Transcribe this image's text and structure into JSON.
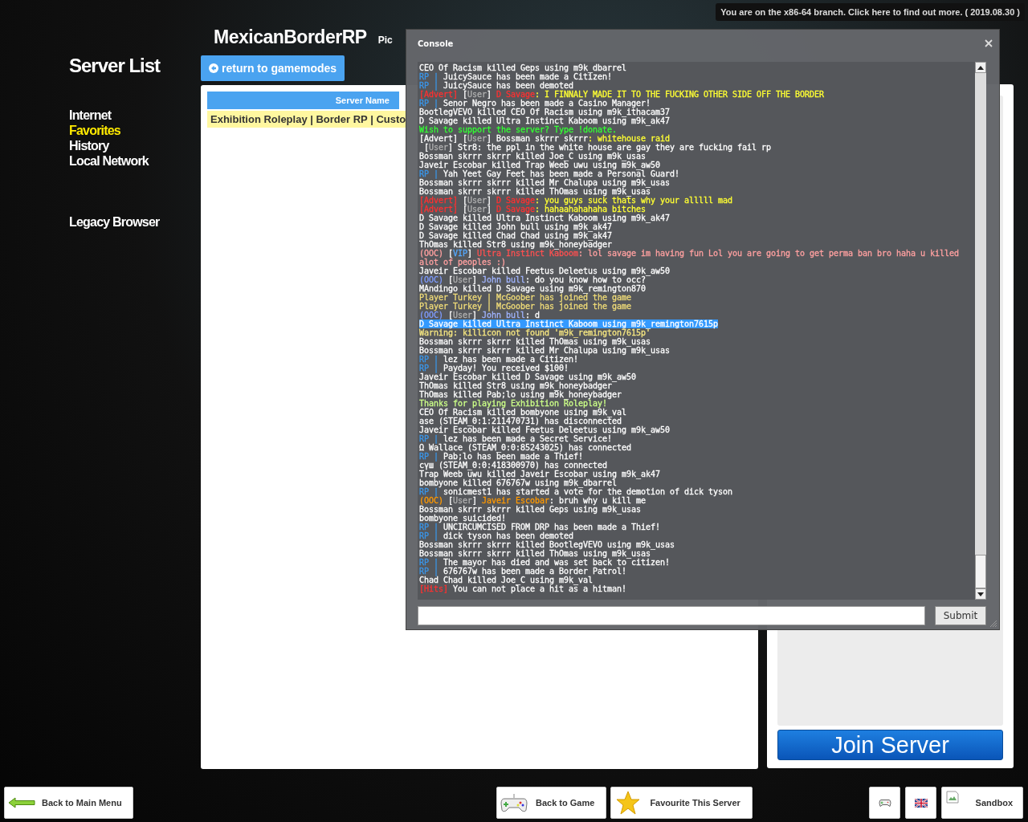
{
  "branch_notice": "You are on the x86-64 branch. Click here to find out more. ( 2019.08.30 )",
  "sidebar": {
    "title": "Server List",
    "items": [
      {
        "label": "Internet",
        "selected": false
      },
      {
        "label": "Favorites",
        "selected": true
      },
      {
        "label": "History",
        "selected": false
      },
      {
        "label": "Local Network",
        "selected": false
      }
    ],
    "legacy": "Legacy Browser"
  },
  "header": {
    "title": "MexicanBorderRP",
    "subtitle": "Pic",
    "back_button": "return to gamemodes"
  },
  "table": {
    "columns": [
      "Server Name"
    ],
    "rows": [
      {
        "name": "Exhibition Roleplay | Border RP | Custo",
        "selected": true
      }
    ]
  },
  "join_button": "Join Server",
  "console": {
    "title": "Console",
    "submit": "Submit",
    "lines": [
      {
        "selected": false,
        "segments": [
          {
            "text": "CEO Of Racism killed Geps using m9k_dbarrel"
          }
        ]
      },
      {
        "selected": false,
        "segments": [
          {
            "text": "RP | ",
            "color": "#3a96ea"
          },
          {
            "text": "JuicySauce has been made a Citizen!"
          }
        ]
      },
      {
        "selected": false,
        "segments": [
          {
            "text": "RP | ",
            "color": "#3a96ea"
          },
          {
            "text": "JuicySauce has been demoted"
          }
        ]
      },
      {
        "selected": false,
        "segments": [
          {
            "text": "[Advert]",
            "color": "#ff3030"
          },
          {
            "text": " ["
          },
          {
            "text": "User",
            "color": "#b0b0b0"
          },
          {
            "text": "] "
          },
          {
            "text": "D Savage",
            "color": "#ff3030"
          },
          {
            "text": ": I FINNALY MADE IT TO THE FUCKING OTHER SIDE OFF THE BORDER",
            "color": "#ffff33"
          }
        ]
      },
      {
        "selected": false,
        "segments": [
          {
            "text": "RP | ",
            "color": "#3a96ea"
          },
          {
            "text": "Senor Negro has been made a Casino Manager!"
          }
        ]
      },
      {
        "selected": false,
        "segments": [
          {
            "text": "BootlegVEVO killed CEO Of Racism using m9k_ithacam37"
          }
        ]
      },
      {
        "selected": false,
        "segments": [
          {
            "text": "D Savage killed Ultra Instinct Kaboom using m9k_ak47"
          }
        ]
      },
      {
        "selected": false,
        "segments": [
          {
            "text": "Wish to support the server? Type !donate.",
            "color": "#33ff33"
          }
        ]
      },
      {
        "selected": false,
        "segments": [
          {
            "text": "[Advert] ["
          },
          {
            "text": "User",
            "color": "#b0b0b0"
          },
          {
            "text": "] Bossman skrrr skrrr"
          },
          {
            "text": ": whitehouse raid",
            "color": "#ffff33"
          }
        ]
      },
      {
        "selected": false,
        "segments": [
          {
            "text": " ["
          },
          {
            "text": "User",
            "color": "#b0b0b0"
          },
          {
            "text": "] Str8: the ppl in the white house are gay they are fucking fail rp"
          }
        ]
      },
      {
        "selected": false,
        "segments": [
          {
            "text": "Bossman skrrr skrrr killed Joe_C using m9k_usas"
          }
        ]
      },
      {
        "selected": false,
        "segments": [
          {
            "text": "Javeir Escobar killed Trap Weeb uwu using m9k_aw50"
          }
        ]
      },
      {
        "selected": false,
        "segments": [
          {
            "text": "RP | ",
            "color": "#3a96ea"
          },
          {
            "text": "Yah Yeet Gay Feet has been made a Personal Guard!"
          }
        ]
      },
      {
        "selected": false,
        "segments": [
          {
            "text": "Bossman skrrr skrrr killed Mr Chalupa using m9k_usas"
          }
        ]
      },
      {
        "selected": false,
        "segments": [
          {
            "text": "Bossman skrrr skrrr killed ThOmas using m9k_usas"
          }
        ]
      },
      {
        "selected": false,
        "segments": [
          {
            "text": "[Advert]",
            "color": "#ff3030"
          },
          {
            "text": " ["
          },
          {
            "text": "User",
            "color": "#b0b0b0"
          },
          {
            "text": "] "
          },
          {
            "text": "D Savage",
            "color": "#ff3030"
          },
          {
            "text": ": you guys suck thats why your alllll mad",
            "color": "#ffff33"
          }
        ]
      },
      {
        "selected": false,
        "segments": [
          {
            "text": "[Advert]",
            "color": "#ff3030"
          },
          {
            "text": " ["
          },
          {
            "text": "User",
            "color": "#b0b0b0"
          },
          {
            "text": "] "
          },
          {
            "text": "D Savage",
            "color": "#ff3030"
          },
          {
            "text": ": hahaahahahaha bitches",
            "color": "#ffff33"
          }
        ]
      },
      {
        "selected": false,
        "segments": [
          {
            "text": "D Savage killed Ultra Instinct Kaboom using m9k_ak47"
          }
        ]
      },
      {
        "selected": false,
        "segments": [
          {
            "text": "D Savage killed John bull using m9k_ak47"
          }
        ]
      },
      {
        "selected": false,
        "segments": [
          {
            "text": "D Savage killed Chad Chad using m9k_ak47"
          }
        ]
      },
      {
        "selected": false,
        "segments": [
          {
            "text": "ThOmas killed Str8 using m9k_honeybadger"
          }
        ]
      },
      {
        "selected": false,
        "segments": [
          {
            "text": "(OOC)",
            "color": "#ffa0a0"
          },
          {
            "text": " ["
          },
          {
            "text": "VIP",
            "color": "#55aaff"
          },
          {
            "text": "] "
          },
          {
            "text": "Ultra Instinct Kaboom",
            "color": "#ff5050"
          },
          {
            "text": ": lol savage im having fun Lol you are going to get perma ban bro haha u killed alot of peoples :)",
            "color": "#ffa0a0"
          }
        ]
      },
      {
        "selected": false,
        "segments": [
          {
            "text": "Javeir Escobar killed Feetus Deleetus using m9k_aw50"
          }
        ]
      },
      {
        "selected": false,
        "segments": [
          {
            "text": "(OOC)",
            "color": "#7f9cff"
          },
          {
            "text": " ["
          },
          {
            "text": "User",
            "color": "#b0b0b0"
          },
          {
            "text": "] "
          },
          {
            "text": "John bull",
            "color": "#a0b4ff"
          },
          {
            "text": ": do you know how to occ?"
          }
        ]
      },
      {
        "selected": false,
        "segments": [
          {
            "text": "MAndingo killed D Savage using m9k_remington870"
          }
        ]
      },
      {
        "selected": false,
        "segments": [
          {
            "text": "Player Turkey | McGoober has joined the game",
            "color": "#f0dc78"
          }
        ]
      },
      {
        "selected": false,
        "segments": [
          {
            "text": "Player Turkey | McGoober has joined the game",
            "color": "#f0dc78"
          }
        ]
      },
      {
        "selected": false,
        "segments": [
          {
            "text": "(OOC)",
            "color": "#7f9cff"
          },
          {
            "text": " ["
          },
          {
            "text": "User",
            "color": "#b0b0b0"
          },
          {
            "text": "] "
          },
          {
            "text": "John bull",
            "color": "#a0b4ff"
          },
          {
            "text": ": d"
          }
        ]
      },
      {
        "selected": true,
        "segments": [
          {
            "text": "D Savage killed Ultra Instinct Kaboom using m9k_remington7615p"
          }
        ]
      },
      {
        "selected": false,
        "segments": [
          {
            "text": "Warning: killicon not found 'm9k_remington7615p'",
            "color": "#f5e680"
          }
        ]
      },
      {
        "selected": false,
        "segments": [
          {
            "text": "Bossman skrrr skrrr killed ThOmas using m9k_usas"
          }
        ]
      },
      {
        "selected": false,
        "segments": [
          {
            "text": "Bossman skrrr skrrr killed Mr Chalupa using m9k_usas"
          }
        ]
      },
      {
        "selected": false,
        "segments": [
          {
            "text": "RP | ",
            "color": "#3a96ea"
          },
          {
            "text": "lez has been made a Citizen!"
          }
        ]
      },
      {
        "selected": false,
        "segments": [
          {
            "text": "RP | ",
            "color": "#3a96ea"
          },
          {
            "text": "Payday! You received $100!"
          }
        ]
      },
      {
        "selected": false,
        "segments": [
          {
            "text": "Javeir Escobar killed D Savage using m9k_aw50"
          }
        ]
      },
      {
        "selected": false,
        "segments": [
          {
            "text": "ThOmas killed Str8 using m9k_honeybadger"
          }
        ]
      },
      {
        "selected": false,
        "segments": [
          {
            "text": "ThOmas killed Pab;lo using m9k_honeybadger"
          }
        ]
      },
      {
        "selected": false,
        "segments": [
          {
            "text": "Thanks for playing Exhibition Roleplay!",
            "color": "#ccff88"
          }
        ]
      },
      {
        "selected": false,
        "segments": [
          {
            "text": "CEO Of Racism killed bombyone using m9k_val"
          }
        ]
      },
      {
        "selected": false,
        "segments": [
          {
            "text": "ase (STEAM_0:1:211470731) has disconnected"
          }
        ]
      },
      {
        "selected": false,
        "segments": [
          {
            "text": "Javeir Escobar killed Feetus Deleetus using m9k_aw50"
          }
        ]
      },
      {
        "selected": false,
        "segments": [
          {
            "text": "RP | ",
            "color": "#3a96ea"
          },
          {
            "text": "lez has been made a Secret Service!"
          }
        ]
      },
      {
        "selected": false,
        "segments": [
          {
            "text": "Ω Wallace (STEAM_0:0:85243025) has connected"
          }
        ]
      },
      {
        "selected": false,
        "segments": [
          {
            "text": "RP | ",
            "color": "#3a96ea"
          },
          {
            "text": "Pab;lo has been made a Thief!"
          }
        ]
      },
      {
        "selected": false,
        "segments": [
          {
            "text": "сүш (STEAM_0:0:418300970) has connected"
          }
        ]
      },
      {
        "selected": false,
        "segments": [
          {
            "text": "Trap Weeb uwu killed Javeir Escobar using m9k_ak47"
          }
        ]
      },
      {
        "selected": false,
        "segments": [
          {
            "text": "bombyone killed 676767w using m9k_dbarrel"
          }
        ]
      },
      {
        "selected": false,
        "segments": [
          {
            "text": "RP | ",
            "color": "#3a96ea"
          },
          {
            "text": "sonicmest1 has started a vote for the demotion of dick tyson"
          }
        ]
      },
      {
        "selected": false,
        "segments": [
          {
            "text": "(OOC)",
            "color": "#ff9900"
          },
          {
            "text": " ["
          },
          {
            "text": "User",
            "color": "#b0b0b0"
          },
          {
            "text": "] "
          },
          {
            "text": "Javeir Escobar",
            "color": "#ff9900"
          },
          {
            "text": ": bruh why u kill me"
          }
        ]
      },
      {
        "selected": false,
        "segments": [
          {
            "text": "Bossman skrrr skrrr killed Geps using m9k_usas"
          }
        ]
      },
      {
        "selected": false,
        "segments": [
          {
            "text": "bombyone suicided!"
          }
        ]
      },
      {
        "selected": false,
        "segments": [
          {
            "text": "RP | ",
            "color": "#3a96ea"
          },
          {
            "text": "UNCIRCUMCISED FROM DRP has been made a Thief!"
          }
        ]
      },
      {
        "selected": false,
        "segments": [
          {
            "text": "RP | ",
            "color": "#3a96ea"
          },
          {
            "text": "dick tyson has been demoted"
          }
        ]
      },
      {
        "selected": false,
        "segments": [
          {
            "text": "Bossman skrrr skrrr killed BootlegVEVO using m9k_usas"
          }
        ]
      },
      {
        "selected": false,
        "segments": [
          {
            "text": "Bossman skrrr skrrr killed ThOmas using m9k_usas"
          }
        ]
      },
      {
        "selected": false,
        "segments": [
          {
            "text": "RP | ",
            "color": "#3a96ea"
          },
          {
            "text": "The mayor has died and was set back to citizen!"
          }
        ]
      },
      {
        "selected": false,
        "segments": [
          {
            "text": "RP | ",
            "color": "#3a96ea"
          },
          {
            "text": "676767w has been made a Border Patrol!"
          }
        ]
      },
      {
        "selected": false,
        "segments": [
          {
            "text": "Chad Chad killed Joe_C using m9k_val"
          }
        ]
      },
      {
        "selected": false,
        "segments": [
          {
            "text": "[Hits]",
            "color": "#ff3030"
          },
          {
            "text": " You can not place a hit as a hitman!"
          }
        ]
      }
    ]
  },
  "bottom_buttons": [
    {
      "kind": "back",
      "label": "Back to Main Menu"
    },
    {
      "kind": "game",
      "label": "Back to Game"
    },
    {
      "kind": "favourite",
      "label": "Favourite This Server"
    },
    {
      "kind": "controller"
    },
    {
      "kind": "language"
    },
    {
      "kind": "gamemode",
      "label": "Sandbox"
    }
  ]
}
